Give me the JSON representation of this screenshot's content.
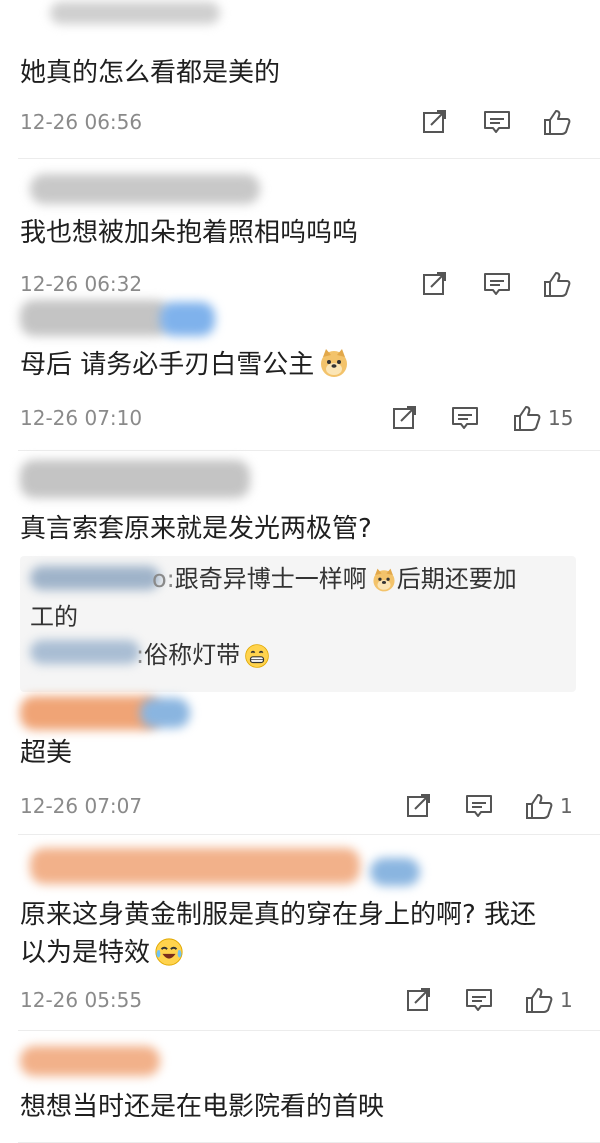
{
  "comments": [
    {
      "text": "她真的怎么看都是美的",
      "time": "12-26 06:56",
      "likes": ""
    },
    {
      "text": "我也想被加朵抱着照相呜呜呜",
      "time": "12-26 06:32",
      "likes": ""
    },
    {
      "text": "母后 请务必手刃白雪公主",
      "time": "12-26 07:10",
      "likes": "15"
    },
    {
      "text": "真言索套原来就是发光两极管?",
      "replies": [
        {
          "name_tail": "o:",
          "text_1": "跟奇异博士一样啊",
          "text_2": "后期还要加",
          "text_3": "工的"
        },
        {
          "name_tail": ":",
          "text_1": "俗称灯带"
        }
      ]
    },
    {
      "text": "超美",
      "time": "12-26 07:07",
      "likes": "1"
    },
    {
      "text_line1": "原来这身黄金制服是真的穿在身上的啊? 我还",
      "text_line2": "以为是特效",
      "time": "12-26 05:55",
      "likes": "1"
    },
    {
      "text": "想想当时还是在电影院看的首映"
    }
  ],
  "icons": {
    "share": "share-icon",
    "comment": "comment-icon",
    "like": "like-icon",
    "doge": "doge-emoji",
    "grin": "grin-emoji",
    "laughcry": "laugh-cry-emoji"
  },
  "colors": {
    "meta": "#8a8a8a",
    "reply_bg": "#f5f5f5"
  }
}
